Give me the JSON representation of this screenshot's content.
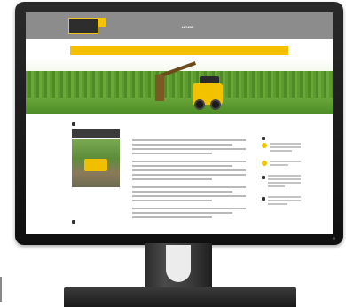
{
  "site": {
    "header": {
      "logo_text": "",
      "nav": [
        {
          "label": "HOME",
          "active": true
        },
        {
          "label": "",
          "active": false
        },
        {
          "label": "",
          "active": false
        },
        {
          "label": "",
          "active": false
        }
      ]
    },
    "hero": {
      "banner_text": ""
    },
    "sidebar_left": {
      "widget_1_title": "",
      "widget_2_title": ""
    },
    "main": {
      "title": ""
    },
    "sidebar_right": {
      "widget_title": ""
    }
  },
  "colors": {
    "accent": "#f5c000",
    "header": "#8c8c8c",
    "hedge": "#5d9a2f",
    "monitor": "#1a1a1a"
  }
}
